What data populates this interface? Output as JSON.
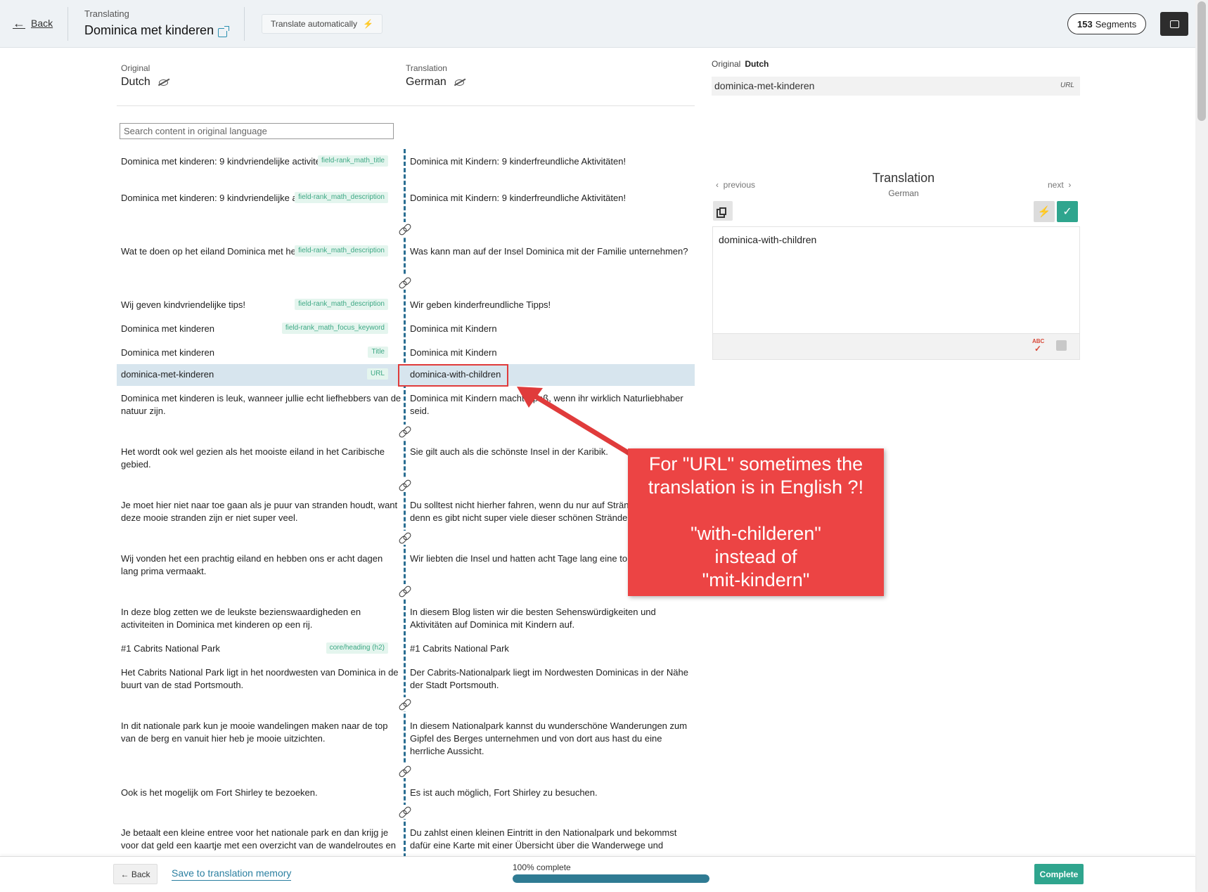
{
  "header": {
    "back_label": "Back",
    "translating_label": "Translating",
    "page_title": "Dominica met kinderen",
    "translate_auto_label": "Translate automatically",
    "segments_count": "153",
    "segments_label": "Segments"
  },
  "columns": {
    "original_label": "Original",
    "original_lang": "Dutch",
    "translation_label": "Translation",
    "translation_lang": "German"
  },
  "search": {
    "placeholder": "Search content in original language"
  },
  "rows": [
    {
      "src": "Dominica met kinderen: 9 kindvriendelijke activiteiten!",
      "tag": "field-rank_math_title",
      "tgt": "Dominica mit Kindern: 9 kinderfreundliche Aktivitäten!"
    },
    {
      "src": "Dominica met kinderen: 9 kindvriendelijke activiteiten!",
      "tag": "field-rank_math_description",
      "tgt": "Dominica mit Kindern: 9 kinderfreundliche Aktivitäten!"
    },
    {
      "src": "Wat te doen op het eiland Dominica met het gezin?",
      "tag": "field-rank_math_description",
      "tgt": "Was kann man auf der Insel Dominica mit der Familie unternehmen?"
    },
    {
      "src": "Wij geven kindvriendelijke tips!",
      "tag": "field-rank_math_description",
      "tgt": "Wir geben kinderfreundliche Tipps!"
    },
    {
      "src": "Dominica met kinderen",
      "tag": "field-rank_math_focus_keyword",
      "tgt": "Dominica mit Kindern"
    },
    {
      "src": "Dominica met kinderen",
      "tag": "Title",
      "tgt": "Dominica mit Kindern"
    },
    {
      "src": "dominica-met-kinderen",
      "tag": "URL",
      "tgt": "dominica-with-children"
    },
    {
      "src": "Dominica met kinderen is leuk, wanneer jullie echt liefhebbers van de natuur zijn.",
      "tag": "",
      "tgt": "Dominica mit Kindern macht Spaß, wenn ihr wirklich Naturliebhaber seid."
    },
    {
      "src": "Het wordt ook wel gezien als het mooiste eiland in het Caribische gebied.",
      "tag": "",
      "tgt": "Sie gilt auch als die schönste Insel in der Karibik."
    },
    {
      "src": "Je moet hier niet naar toe gaan als je puur van stranden houdt, want deze mooie stranden zijn er niet super veel.",
      "tag": "",
      "tgt": "Du solltest nicht hierher fahren, wenn du nur auf Strände stehst, denn es gibt nicht super viele dieser schönen Strände."
    },
    {
      "src": "Wij vonden het een prachtig eiland en hebben ons er acht dagen lang prima vermaakt.",
      "tag": "",
      "tgt": "Wir liebten die Insel und hatten acht Tage lang eine tolle Zeit."
    },
    {
      "src": "In deze blog zetten we de leukste bezienswaardigheden en activiteiten in Dominica met kinderen op een rij.",
      "tag": "",
      "tgt": "In diesem Blog listen wir die besten Sehenswürdigkeiten und Aktivitäten auf Dominica mit Kindern auf."
    },
    {
      "src": "#1 Cabrits National Park",
      "tag": "core/heading (h2)",
      "tgt": "#1 Cabrits National Park"
    },
    {
      "src": "Het Cabrits National Park ligt in het noordwesten van Dominica in de buurt van de stad Portsmouth.",
      "tag": "",
      "tgt": "Der Cabrits-Nationalpark liegt im Nordwesten Dominicas in der Nähe der Stadt Portsmouth."
    },
    {
      "src": "In dit nationale park kun je mooie wandelingen maken naar de top van de berg en vanuit hier heb je mooie uitzichten.",
      "tag": "",
      "tgt": "In diesem Nationalpark kannst du wunderschöne Wanderungen zum Gipfel des Berges unternehmen und von dort aus hast du eine herrliche Aussicht."
    },
    {
      "src": "Ook is het mogelijk om Fort Shirley te bezoeken.",
      "tag": "",
      "tgt": "Es ist auch möglich, Fort Shirley zu besuchen."
    },
    {
      "src": "Je betaalt een kleine entree voor het nationale park en dan krijg je voor dat geld een kaartje met een overzicht van de wandelroutes en",
      "tag": "",
      "tgt": "Du zahlst einen kleinen Eintritt in den Nationalpark und bekommst dafür eine Karte mit einer Übersicht über die Wanderwege und"
    }
  ],
  "callout": {
    "line1": "For \"URL\" sometimes the",
    "line2": "translation is in English ?!",
    "line3": "\"with-childeren\"",
    "line4": "instead of",
    "line5": "\"mit-kindern\""
  },
  "panel": {
    "original_label": "Original",
    "original_lang": "Dutch",
    "original_value": "dominica-met-kinderen",
    "url_tag": "URL",
    "previous": "previous",
    "next": "next",
    "title": "Translation",
    "subtitle": "German",
    "translation_value": "dominica-with-children"
  },
  "footer": {
    "back_label": "← Back",
    "save_label": "Save to translation memory",
    "progress_label": "100% complete",
    "progress": 1.0,
    "complete_label": "Complete"
  },
  "colors": {
    "accent": "#2fa58e",
    "progress": "#2f7b93",
    "callout": "#ec4444",
    "active_row": "#d7e5ee"
  }
}
